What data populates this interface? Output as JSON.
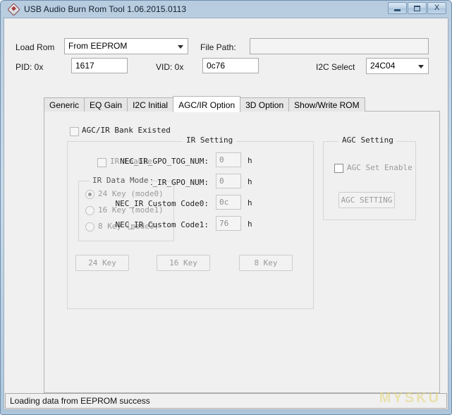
{
  "window": {
    "title": "USB Audio Burn Rom Tool 1.06.2015.0113",
    "icon": "app-gem-icon",
    "buttons": {
      "minimize": "minimize-icon",
      "maximize": "maximize-icon",
      "close": "X"
    }
  },
  "top_controls": {
    "load_rom_label": "Load Rom",
    "load_rom_value": "From EEPROM",
    "file_path_label": "File Path:",
    "file_path_value": "",
    "pid_label": "PID: 0x",
    "pid_value": "1617",
    "vid_label": "VID: 0x",
    "vid_value": "0c76",
    "i2c_label": "I2C Select",
    "i2c_value": "24C04"
  },
  "tabs": [
    {
      "label": "Generic",
      "active": false
    },
    {
      "label": "EQ Gain",
      "active": false
    },
    {
      "label": "I2C Initial",
      "active": false
    },
    {
      "label": "AGC/IR Option",
      "active": true
    },
    {
      "label": "3D Option",
      "active": false
    },
    {
      "label": "Show/Write ROM",
      "active": false
    }
  ],
  "agc_ir_panel": {
    "bank_existed_label": "AGC/IR Bank Existed",
    "bank_existed_checked": false,
    "ir_setting": {
      "title": "IR Setting",
      "ir_enable_label": "IR Enable",
      "ir_enable_checked": false,
      "data_mode": {
        "title": "IR Data Mode",
        "options": [
          {
            "label": "24 Key (mode0)",
            "selected": true
          },
          {
            "label": "16 Key (mode1)",
            "selected": false
          },
          {
            "label": "8 Key (mode3)",
            "selected": false
          }
        ]
      },
      "fields": [
        {
          "label": "NEC_IR_GPO_TOG_NUM:",
          "value": "0",
          "unit": "h"
        },
        {
          "label": "NEC_IR_GPO_NUM:",
          "value": "0",
          "unit": "h"
        },
        {
          "label": "NEC_IR Custom Code0:",
          "value": "0c",
          "unit": "h"
        },
        {
          "label": "NEC_IR Custom Code1:",
          "value": "76",
          "unit": "h"
        }
      ],
      "key_buttons": [
        {
          "label": "24 Key"
        },
        {
          "label": "16 Key"
        },
        {
          "label": "8 Key"
        }
      ]
    },
    "agc_setting": {
      "title": "AGC Setting",
      "agc_enable_label": "AGC Set Enable",
      "agc_enable_checked": false,
      "agc_button_label": "AGC SETTING"
    }
  },
  "status_bar": {
    "message": "Loading data from EEPROM success",
    "watermark": "MYSKU"
  },
  "colors": {
    "window_frame": "#b7ccdf",
    "client_background": "#f0f0f0",
    "active_tab": "#ffffff",
    "inactive_tab": "#e6e6e6",
    "text": "#1a1a1a",
    "disabled_text": "#9a9a9a"
  }
}
